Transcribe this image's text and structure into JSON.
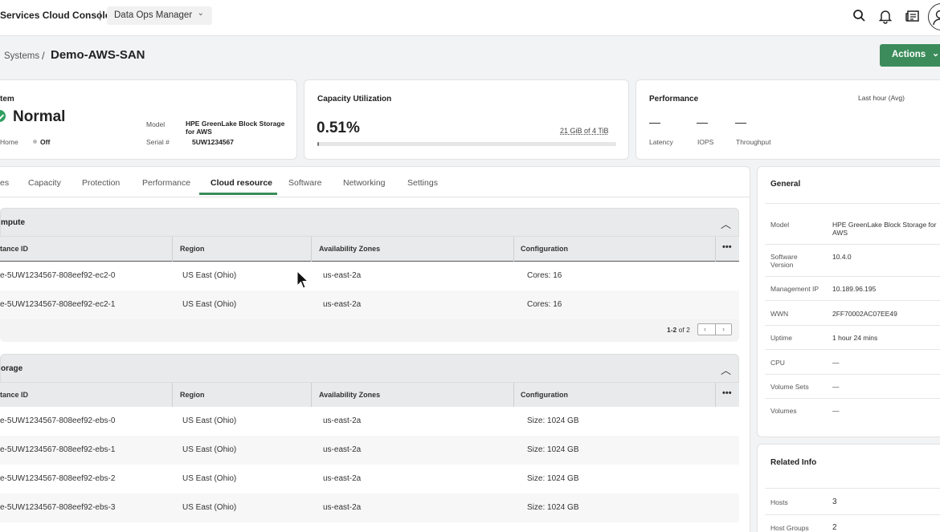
{
  "topbar": {
    "app_title": "Services Cloud Console",
    "separator": "|",
    "workspace": "Data Ops Manager",
    "icons": [
      "search-icon",
      "bell-icon",
      "news-icon",
      "user-avatar-icon"
    ]
  },
  "header": {
    "breadcrumb_parent": "Systems",
    "breadcrumb_separator": "/",
    "title": "Demo-AWS-SAN",
    "actions_label": "Actions"
  },
  "system_card": {
    "label": "tem",
    "status": "Normal",
    "home_label": "Home",
    "home_value": "Off",
    "model_label": "Model",
    "model_value": "HPE GreenLake Block Storage for AWS",
    "serial_label": "Serial #",
    "serial_value": "5UW1234567"
  },
  "capacity_card": {
    "title": "Capacity Utilization",
    "percent": "0.51%",
    "percent_value": 0.51,
    "used_text": "21 GiB of 4 TiB"
  },
  "performance_card": {
    "title": "Performance",
    "range": "Last hour (Avg)",
    "metrics": [
      {
        "value": "—",
        "label": "Latency"
      },
      {
        "value": "—",
        "label": "IOPS"
      },
      {
        "value": "—",
        "label": "Throughput"
      }
    ]
  },
  "tabs": [
    "es",
    "Capacity",
    "Protection",
    "Performance",
    "Cloud resource",
    "Software",
    "Networking",
    "Settings"
  ],
  "active_tab": "Cloud resource",
  "compute": {
    "title": "mpute",
    "columns": [
      "tance ID",
      "Region",
      "Availability Zones",
      "Configuration"
    ],
    "rows": [
      [
        "e-5UW1234567-808eef92-ec2-0",
        "US East (Ohio)",
        "us-east-2a",
        "Cores: 16"
      ],
      [
        "e-5UW1234567-808eef92-ec2-1",
        "US East (Ohio)",
        "us-east-2a",
        "Cores: 16"
      ]
    ],
    "pager_range": "1-2",
    "pager_of": "of 2"
  },
  "storage": {
    "title": "orage",
    "columns": [
      "tance ID",
      "Region",
      "Availability Zones",
      "Configuration"
    ],
    "rows": [
      [
        "e-5UW1234567-808eef92-ebs-0",
        "US East (Ohio)",
        "us-east-2a",
        "Size: 1024 GB"
      ],
      [
        "e-5UW1234567-808eef92-ebs-1",
        "US East (Ohio)",
        "us-east-2a",
        "Size: 1024 GB"
      ],
      [
        "e-5UW1234567-808eef92-ebs-2",
        "US East (Ohio)",
        "us-east-2a",
        "Size: 1024 GB"
      ],
      [
        "e-5UW1234567-808eef92-ebs-3",
        "US East (Ohio)",
        "us-east-2a",
        "Size: 1024 GB"
      ]
    ]
  },
  "general": {
    "title": "General",
    "items": [
      {
        "label": "Model",
        "value": "HPE GreenLake Block Storage for AWS"
      },
      {
        "label": "Software Version",
        "value": "10.4.0"
      },
      {
        "label": "Management IP",
        "value": "10.189.96.195"
      },
      {
        "label": "WWN",
        "value": "2FF70002AC07EE49"
      },
      {
        "label": "Uptime",
        "value": "1 hour 24 mins"
      },
      {
        "label": "CPU",
        "value": "—"
      },
      {
        "label": "Volume Sets",
        "value": "—"
      },
      {
        "label": "Volumes",
        "value": "—"
      }
    ]
  },
  "related": {
    "title": "Related Info",
    "items": [
      {
        "label": "Hosts",
        "value": "3"
      },
      {
        "label": "Host Groups",
        "value": "2"
      }
    ]
  },
  "colors": {
    "accent": "#3b8c5a",
    "status_ok": "#2f9e5f"
  }
}
